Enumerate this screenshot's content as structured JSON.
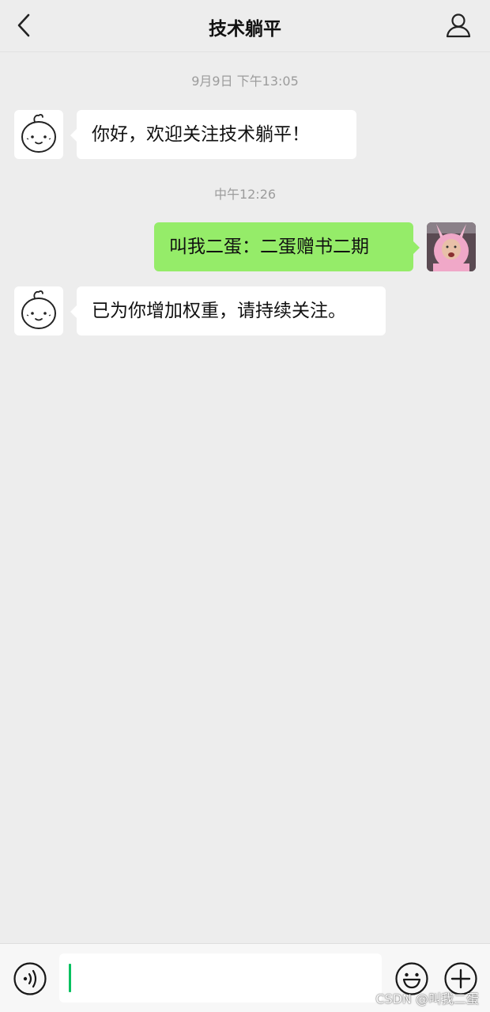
{
  "header": {
    "title": "技术躺平",
    "back_icon": "chevron-left-icon",
    "profile_icon": "person-icon"
  },
  "messages": [
    {
      "type": "timestamp",
      "text": "9月9日 下午13:05"
    },
    {
      "type": "incoming",
      "text": "你好，欢迎关注技术躺平！",
      "avatar": "cartoon-face-avatar"
    },
    {
      "type": "timestamp",
      "text": "中午12:26"
    },
    {
      "type": "outgoing",
      "text": "叫我二蛋：二蛋赠书二期",
      "avatar": "pink-bunny-costume-avatar"
    },
    {
      "type": "incoming",
      "text": "已为你增加权重，请持续关注。",
      "avatar": "cartoon-face-avatar"
    }
  ],
  "input_bar": {
    "value": "",
    "voice_icon": "voice-icon",
    "emoji_icon": "emoji-icon",
    "plus_icon": "plus-icon"
  },
  "colors": {
    "background": "#ededed",
    "outgoing_bubble": "#95ec69",
    "incoming_bubble": "#ffffff",
    "caret": "#07c160"
  },
  "watermark": "CSDN @叫我二蛋"
}
